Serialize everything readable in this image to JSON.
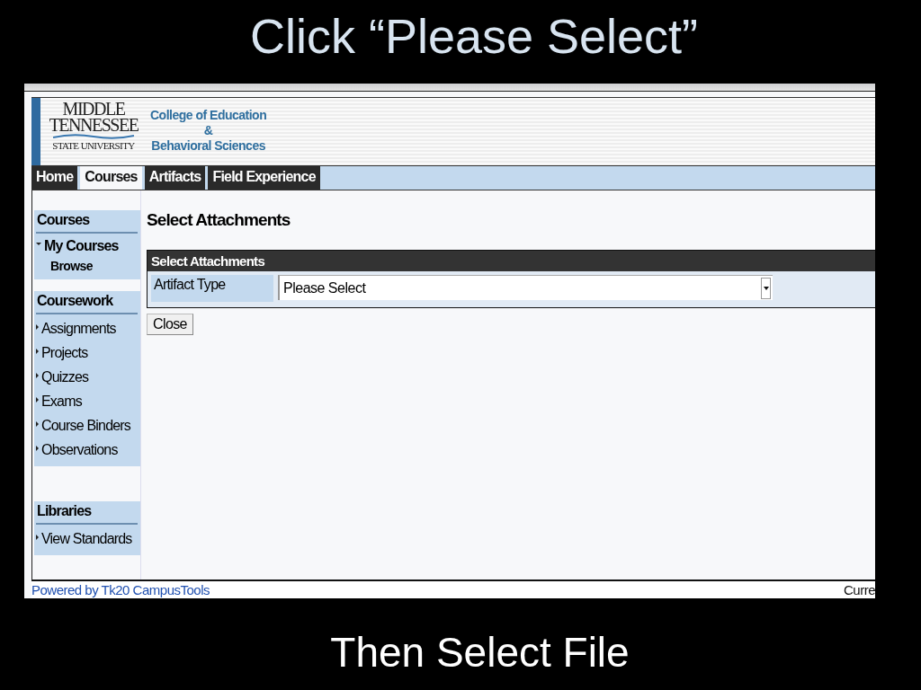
{
  "slide": {
    "title": "Click “Please Select”",
    "caption": "Then Select File"
  },
  "header": {
    "logo_lines": [
      "MIDDLE",
      "TENNESSEE",
      "STATE UNIVERSITY"
    ],
    "college_lines": [
      "College of Education",
      "&",
      "Behavioral Sciences"
    ]
  },
  "tabs": [
    {
      "label": "Home",
      "selected": false
    },
    {
      "label": "Courses",
      "selected": true
    },
    {
      "label": "Artifacts",
      "selected": false
    },
    {
      "label": "Field Experience",
      "selected": false
    }
  ],
  "sidebar": {
    "sections": [
      {
        "title": "Courses",
        "items": [
          {
            "label": "My Courses",
            "expanded": true,
            "children": [
              {
                "label": "Browse"
              }
            ]
          }
        ]
      },
      {
        "title": "Coursework",
        "items": [
          {
            "label": "Assignments",
            "expanded": false
          },
          {
            "label": "Projects",
            "expanded": false
          },
          {
            "label": "Quizzes",
            "expanded": false
          },
          {
            "label": "Exams",
            "expanded": false
          },
          {
            "label": "Course Binders",
            "expanded": false
          },
          {
            "label": "Observations",
            "expanded": false
          }
        ]
      },
      {
        "title": "Libraries",
        "items": [
          {
            "label": "View Standards",
            "expanded": false
          }
        ]
      }
    ]
  },
  "main": {
    "heading": "Select Attachments",
    "panel": {
      "title": "Select Attachments",
      "field_label": "Artifact Type",
      "select_value": "Please Select"
    },
    "close_button": "Close"
  },
  "footer": {
    "link": "Powered by Tk20 CampusTools",
    "right_text": "Curre"
  }
}
